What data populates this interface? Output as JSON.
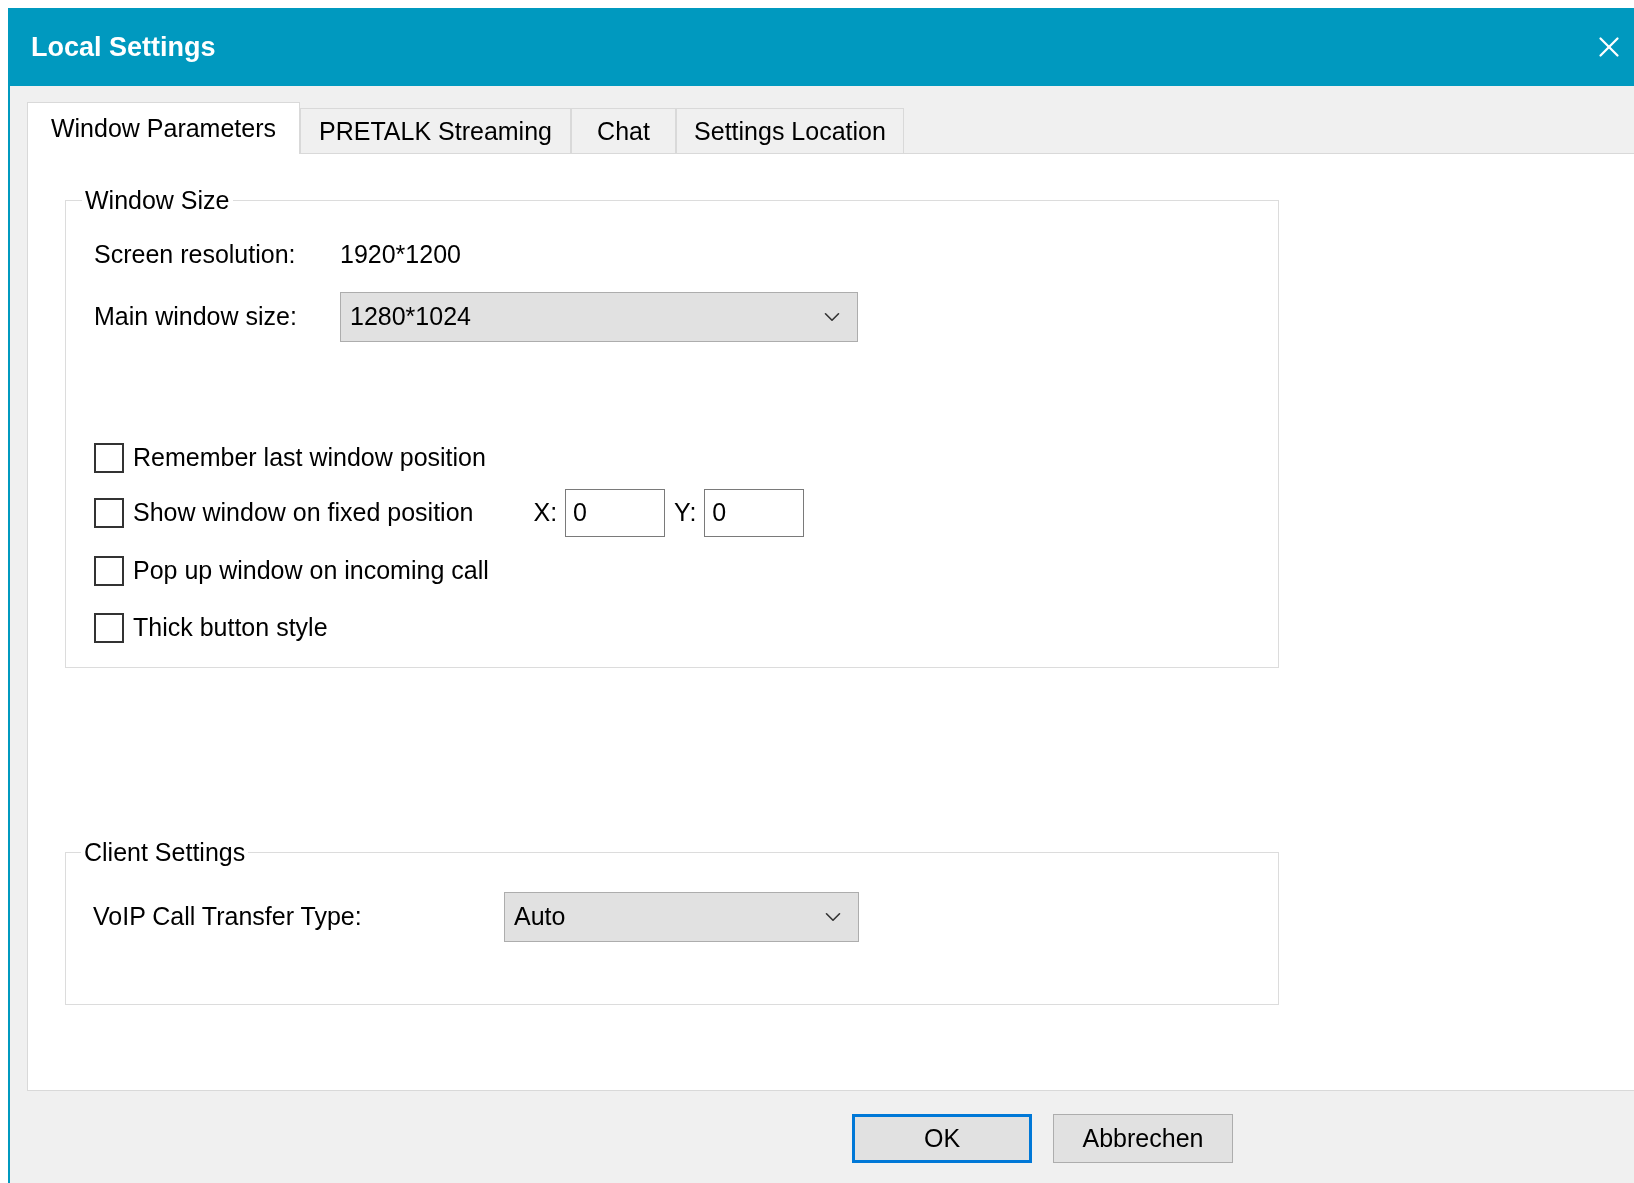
{
  "window": {
    "title": "Local Settings"
  },
  "tabs": [
    {
      "label": "Window Parameters",
      "selected": true
    },
    {
      "label": "PRETALK Streaming",
      "selected": false
    },
    {
      "label": "Chat",
      "selected": false
    },
    {
      "label": "Settings Location",
      "selected": false
    }
  ],
  "window_size": {
    "title": "Window Size",
    "screen_resolution_label": "Screen resolution:",
    "screen_resolution": "1920*1200",
    "main_window_label": "Main window size:",
    "main_window_value": "1280*1024",
    "options": [
      {
        "label": "Remember last window position",
        "checked": false
      },
      {
        "label": "Show window on fixed position",
        "checked": false,
        "x_label": "X:",
        "x_value": "0",
        "y_label": "Y:",
        "y_value": "0"
      },
      {
        "label": "Pop up window on incoming call",
        "checked": false
      },
      {
        "label": "Thick button style",
        "checked": false
      }
    ]
  },
  "client_settings": {
    "title": "Client Settings",
    "voip_label": "VoIP Call Transfer Type:",
    "voip_value": "Auto"
  },
  "buttons": [
    {
      "label": "OK",
      "default": true
    },
    {
      "label": "Abbrechen",
      "default": false
    }
  ]
}
